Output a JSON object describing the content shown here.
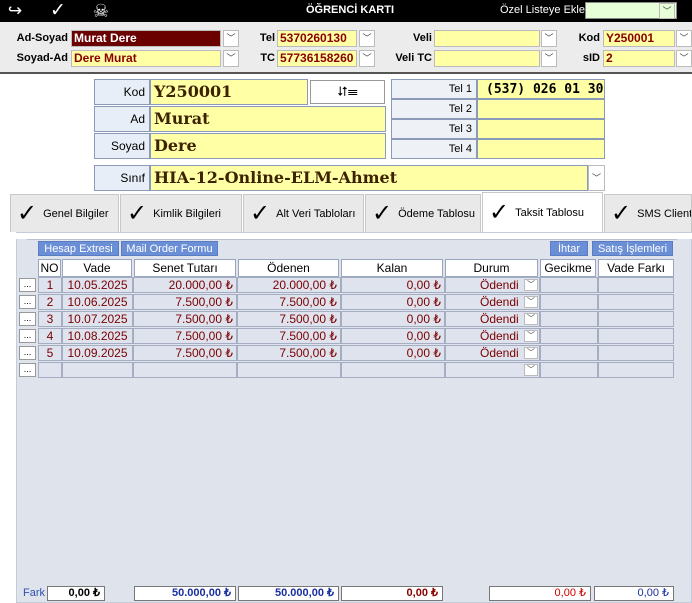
{
  "titlebar": {
    "title": "ÖĞRENCİ KARTI",
    "favorites_label": "Özel Listeye Ekle",
    "icons": [
      "exit-arrow-icon",
      "check-icon",
      "skull-icon"
    ],
    "exit_glyph": "↪",
    "check_glyph": "✓",
    "skull_glyph": "☠"
  },
  "search": {
    "ad_soyad_label": "Ad-Soyad",
    "ad_soyad_value": "Murat Dere",
    "soyad_ad_label": "Soyad-Ad",
    "soyad_ad_value": "Dere Murat",
    "tel_label": "Tel",
    "tel_value": "5370260130",
    "tc_label": "TC",
    "tc_value": "57736158260",
    "veli_label": "Veli",
    "veli_value": "",
    "veli_tc_label": "Veli TC",
    "veli_tc_value": "",
    "kod_label": "Kod",
    "kod_value": "Y250001",
    "sid_label": "sID",
    "sid_value": "2"
  },
  "card": {
    "kod_label": "Kod",
    "kod_value": "Y250001",
    "ad_label": "Ad",
    "ad_value": "Murat",
    "soyad_label": "Soyad",
    "soyad_value": "Dere",
    "sinif_label": "Sınıf",
    "sinif_value": "HIA-12-Online-ELM-Ahmet",
    "tel1_label": "Tel 1",
    "tel1_value": "(537) 026 01 30",
    "tel2_label": "Tel 2",
    "tel2_value": "",
    "tel3_label": "Tel 3",
    "tel3_value": "",
    "tel4_label": "Tel 4",
    "tel4_value": ""
  },
  "tabs": [
    {
      "label": "Genel Bilgiler"
    },
    {
      "label": "Kimlik  Bilgileri"
    },
    {
      "label": "Alt Veri Tabloları"
    },
    {
      "label": "Ödeme Tablosu"
    },
    {
      "label": "Taksit Tablosu"
    },
    {
      "label": "SMS Client"
    }
  ],
  "toolbar": {
    "hesap_extresi": "Hesap Extresi",
    "mail_order": "Mail Order Formu",
    "ihtar": "İhtar",
    "satis_islemleri": "Satış İşlemleri"
  },
  "table": {
    "headers": [
      "NO",
      "Vade",
      "Senet Tutarı",
      "Ödenen",
      "Kalan",
      "Durum",
      "Gecikme",
      "Vade Farkı"
    ],
    "row_button": "...",
    "rows": [
      {
        "no": "1",
        "vade": "10.05.2025",
        "senet": "20.000,00 ₺",
        "odenen": "20.000,00 ₺",
        "kalan": "0,00 ₺",
        "durum": "Ödendi"
      },
      {
        "no": "2",
        "vade": "10.06.2025",
        "senet": "7.500,00 ₺",
        "odenen": "7.500,00 ₺",
        "kalan": "0,00 ₺",
        "durum": "Ödendi"
      },
      {
        "no": "3",
        "vade": "10.07.2025",
        "senet": "7.500,00 ₺",
        "odenen": "7.500,00 ₺",
        "kalan": "0,00 ₺",
        "durum": "Ödendi"
      },
      {
        "no": "4",
        "vade": "10.08.2025",
        "senet": "7.500,00 ₺",
        "odenen": "7.500,00 ₺",
        "kalan": "0,00 ₺",
        "durum": "Ödendi"
      },
      {
        "no": "5",
        "vade": "10.09.2025",
        "senet": "7.500,00 ₺",
        "odenen": "7.500,00 ₺",
        "kalan": "0,00 ₺",
        "durum": "Ödendi"
      }
    ]
  },
  "footer": {
    "fark_label": "Fark",
    "fark_value": "0,00 ₺",
    "senet_total": "50.000,00 ₺",
    "odenen_total": "50.000,00 ₺",
    "kalan_total": "0,00 ₺",
    "gecikme_total": "0,00 ₺",
    "vade_farki_total": "0,00 ₺"
  },
  "colors": {
    "dark_red": "#7a0000",
    "field_yellow": "#ffffa6",
    "button_blue": "#6b8fd6",
    "total_blue": "#1a2fa0"
  }
}
